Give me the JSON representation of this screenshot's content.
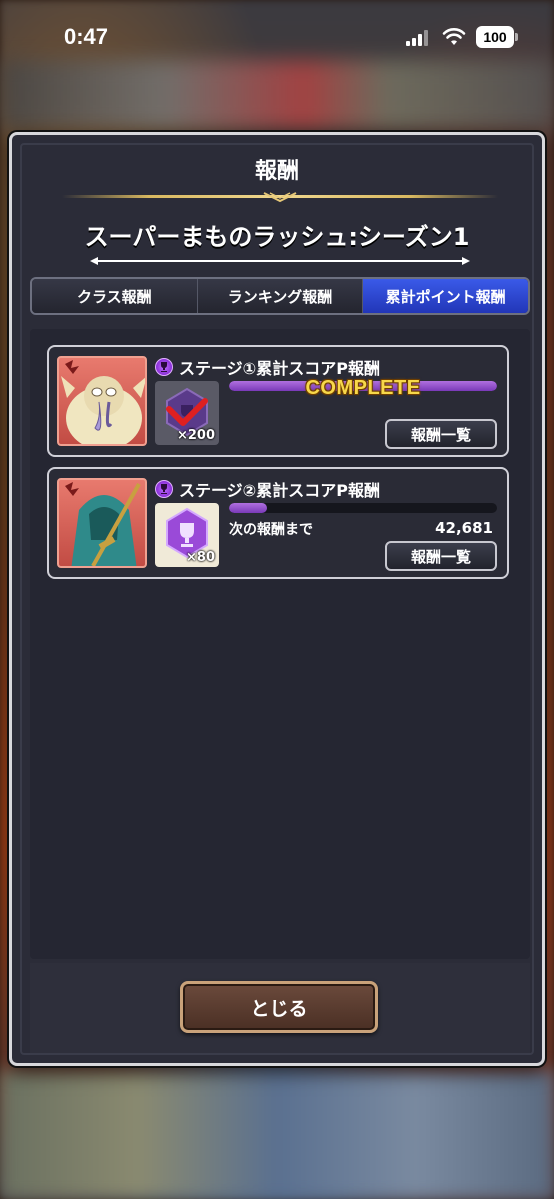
{
  "status_bar": {
    "time": "0:47",
    "battery": "100"
  },
  "dialog": {
    "title": "報酬",
    "subtitle": "スーパーまものラッシュ:シーズン1",
    "tabs": [
      {
        "label": "クラス報酬",
        "active": false
      },
      {
        "label": "ランキング報酬",
        "active": false
      },
      {
        "label": "累計ポイント報酬",
        "active": true
      }
    ],
    "rewards": [
      {
        "title": "ステージ①累計スコアP報酬",
        "reward_count": "×200",
        "progress": 1.0,
        "status": "COMPLETE",
        "button": "報酬一覧"
      },
      {
        "title": "ステージ②累計スコアP報酬",
        "reward_count": "×80",
        "progress": 0.14,
        "next_label": "次の報酬まで",
        "next_value": "42,681",
        "button": "報酬一覧"
      }
    ],
    "close_label": "とじる"
  }
}
